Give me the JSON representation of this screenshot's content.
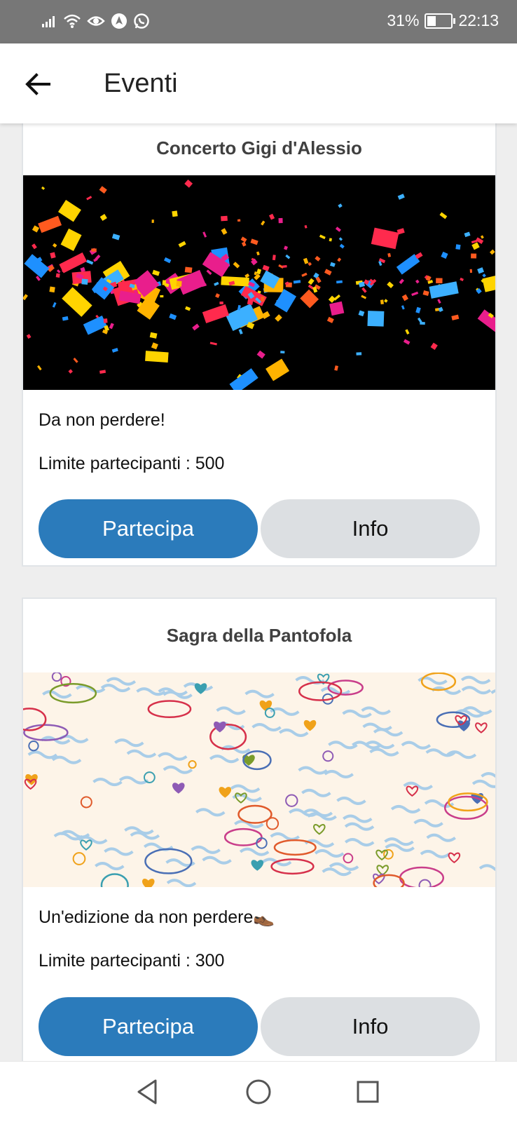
{
  "status_bar": {
    "battery": "31%",
    "time": "22:13",
    "icons": [
      "signal-icon",
      "wifi-icon",
      "eye-icon",
      "navigation-icon",
      "whatsapp-icon"
    ]
  },
  "app_bar": {
    "title": "Eventi",
    "back_icon": "arrow-left-icon"
  },
  "events": [
    {
      "title": "Concerto Gigi d'Alessio",
      "image": "confetti-photo",
      "description": "Da non perdere!",
      "limit": "Limite partecipanti : 500",
      "join_label": "Partecipa",
      "info_label": "Info"
    },
    {
      "title": "Sagra della Pantofola",
      "image": "doodle-pattern-photo",
      "description": "Un'edizione da non perdere👞",
      "limit": "Limite partecipanti : 300",
      "join_label": "Partecipa",
      "info_label": "Info"
    }
  ],
  "nav_bar": {
    "icons": [
      "back-triangle-icon",
      "home-circle-icon",
      "recents-square-icon"
    ]
  },
  "colors": {
    "primary": "#2b7bbb",
    "secondary": "#dcdfe2",
    "status_bar": "#777777",
    "background": "#eeeeee"
  }
}
